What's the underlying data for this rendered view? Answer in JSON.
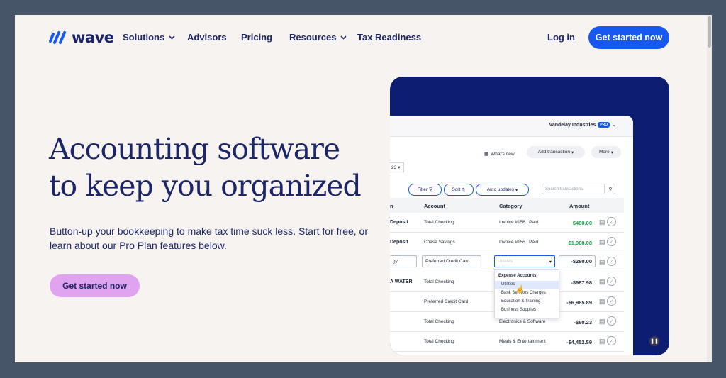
{
  "brand": {
    "name": "wave",
    "color": "#1c2566",
    "accent": "#1759f0",
    "cta_hero_color": "#e0a3f0"
  },
  "nav": {
    "items": [
      {
        "label": "Solutions",
        "has_menu": true
      },
      {
        "label": "Advisors",
        "has_menu": false
      },
      {
        "label": "Pricing",
        "has_menu": false
      },
      {
        "label": "Resources",
        "has_menu": true
      },
      {
        "label": "Tax Readiness",
        "has_menu": false
      }
    ],
    "login": "Log in",
    "cta": "Get started now"
  },
  "hero": {
    "title_line1": "Accounting software",
    "title_line2": "to keep you organized",
    "subtitle": "Button-up your bookkeeping to make tax time suck less. Start for free, or learn about our Pro Plan features below.",
    "cta": "Get started now"
  },
  "app": {
    "company": "Vandelay Industries",
    "plan_badge": "PRO",
    "whats_new": "What's new",
    "add_transaction": "Add transaction",
    "more": "More",
    "date_fragment": "23",
    "filter": "Filter",
    "sort": "Sort",
    "auto_updates": "Auto updates",
    "search_placeholder": "Search transactions",
    "columns": {
      "desc": "n",
      "account": "Account",
      "category": "Category",
      "amount": "Amount"
    },
    "rows": [
      {
        "desc": "Deposit",
        "account": "Total Checking",
        "category": "Invoice #156 | Paid",
        "amount": "$480.00",
        "positive": true
      },
      {
        "desc": "Deposit",
        "account": "Chase Savings",
        "category": "Invoice #155 | Paid",
        "amount": "$1,908.08",
        "positive": true
      },
      {
        "desc": "gy",
        "account": "Preferred Credit Card",
        "category": "Utilities",
        "amount": "-$280.00",
        "positive": false,
        "editing": true
      },
      {
        "desc": "A WATER",
        "account": "Total Checking",
        "category": "",
        "amount": "-$987.98",
        "positive": false
      },
      {
        "desc": "",
        "account": "Preferred Credit Card",
        "category": "",
        "amount": "-$6,985.89",
        "positive": false
      },
      {
        "desc": "",
        "account": "Total Checking",
        "category": "Electronics & Software",
        "amount": "-$80.23",
        "positive": false
      },
      {
        "desc": "",
        "account": "Total Checking",
        "category": "Meals & Entertainment",
        "amount": "-$4,452.59",
        "positive": false
      }
    ],
    "dropdown": {
      "header": "Expense Accounts",
      "options": [
        "Utilities",
        "Bank Services Charges",
        "Education & Training",
        "Business Supplies"
      ],
      "selected": "Utilities"
    }
  }
}
